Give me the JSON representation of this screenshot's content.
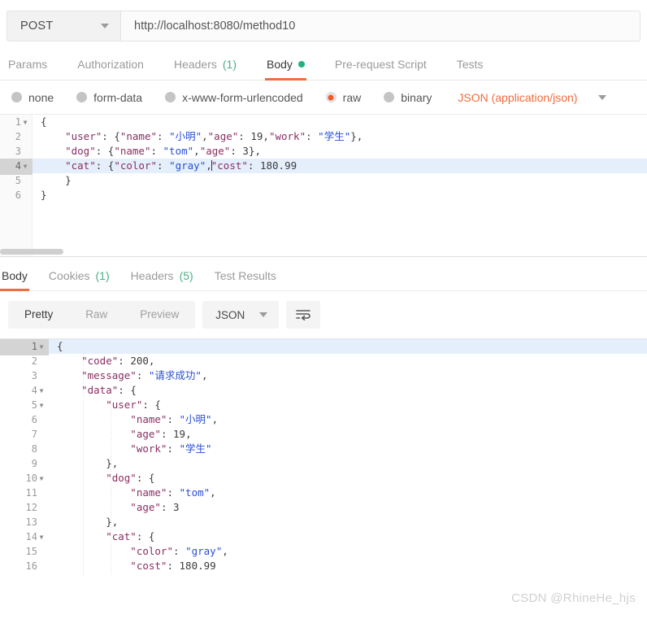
{
  "urlbar": {
    "method": "POST",
    "url": "http://localhost:8080/method10",
    "method_caret": "chevron-down-icon"
  },
  "request_tabs": [
    {
      "label": "Params",
      "active": false,
      "count": "",
      "dot": false
    },
    {
      "label": "Authorization",
      "active": false,
      "count": "",
      "dot": false
    },
    {
      "label": "Headers",
      "active": false,
      "count": "(1)",
      "dot": false
    },
    {
      "label": "Body",
      "active": true,
      "count": "",
      "dot": true
    },
    {
      "label": "Pre-request Script",
      "active": false,
      "count": "",
      "dot": false
    },
    {
      "label": "Tests",
      "active": false,
      "count": "",
      "dot": false
    }
  ],
  "body_types": [
    {
      "label": "none",
      "selected": false
    },
    {
      "label": "form-data",
      "selected": false
    },
    {
      "label": "x-www-form-urlencoded",
      "selected": false
    },
    {
      "label": "raw",
      "selected": true
    },
    {
      "label": "binary",
      "selected": false
    }
  ],
  "content_type": {
    "label": "JSON (application/json)",
    "caret": "chevron-down-icon"
  },
  "request_body": {
    "language": "json",
    "highlighted_line": 4,
    "lines": [
      {
        "n": "1",
        "fold": true,
        "tokens": [
          {
            "t": "{",
            "c": "p"
          }
        ]
      },
      {
        "n": "2",
        "fold": false,
        "tokens": [
          {
            "t": "    \"user\"",
            "c": "k"
          },
          {
            "t": ": {",
            "c": "p"
          },
          {
            "t": "\"name\"",
            "c": "k"
          },
          {
            "t": ": ",
            "c": "p"
          },
          {
            "t": "\"小明\"",
            "c": "s"
          },
          {
            "t": ",",
            "c": "p"
          },
          {
            "t": "\"age\"",
            "c": "k"
          },
          {
            "t": ": ",
            "c": "p"
          },
          {
            "t": "19",
            "c": "n"
          },
          {
            "t": ",",
            "c": "p"
          },
          {
            "t": "\"work\"",
            "c": "k"
          },
          {
            "t": ": ",
            "c": "p"
          },
          {
            "t": "\"学生\"",
            "c": "s"
          },
          {
            "t": "},",
            "c": "p"
          }
        ]
      },
      {
        "n": "3",
        "fold": false,
        "tokens": [
          {
            "t": "    \"dog\"",
            "c": "k"
          },
          {
            "t": ": {",
            "c": "p"
          },
          {
            "t": "\"name\"",
            "c": "k"
          },
          {
            "t": ": ",
            "c": "p"
          },
          {
            "t": "\"tom\"",
            "c": "s"
          },
          {
            "t": ",",
            "c": "p"
          },
          {
            "t": "\"age\"",
            "c": "k"
          },
          {
            "t": ": ",
            "c": "p"
          },
          {
            "t": "3",
            "c": "n"
          },
          {
            "t": "},",
            "c": "p"
          }
        ]
      },
      {
        "n": "4",
        "fold": true,
        "cursor_after": 5,
        "tokens": [
          {
            "t": "    \"cat\"",
            "c": "k"
          },
          {
            "t": ": {",
            "c": "p"
          },
          {
            "t": "\"color\"",
            "c": "k"
          },
          {
            "t": ": ",
            "c": "p"
          },
          {
            "t": "\"gray\"",
            "c": "s"
          },
          {
            "t": ",",
            "c": "p"
          },
          {
            "t": "\"cost\"",
            "c": "k"
          },
          {
            "t": ": ",
            "c": "p"
          },
          {
            "t": "180.99",
            "c": "n"
          }
        ]
      },
      {
        "n": "5",
        "fold": false,
        "tokens": [
          {
            "t": "    }",
            "c": "p"
          }
        ]
      },
      {
        "n": "6",
        "fold": false,
        "tokens": [
          {
            "t": "}",
            "c": "p"
          }
        ]
      }
    ]
  },
  "response_tabs": [
    {
      "label": "Body",
      "active": true,
      "count": ""
    },
    {
      "label": "Cookies",
      "active": false,
      "count": "(1)"
    },
    {
      "label": "Headers",
      "active": false,
      "count": "(5)"
    },
    {
      "label": "Test Results",
      "active": false,
      "count": ""
    }
  ],
  "response_toolbar": {
    "views": [
      {
        "label": "Pretty",
        "active": true
      },
      {
        "label": "Raw",
        "active": false
      },
      {
        "label": "Preview",
        "active": false
      }
    ],
    "format": "JSON",
    "format_caret": "chevron-down-icon",
    "wrap_button": "word-wrap-icon"
  },
  "response_body": {
    "language": "json",
    "highlighted_line": 1,
    "lines": [
      {
        "n": "1",
        "fold": true,
        "tokens": [
          {
            "t": "{",
            "c": "p"
          }
        ]
      },
      {
        "n": "2",
        "fold": false,
        "tokens": [
          {
            "t": "    \"code\"",
            "c": "k"
          },
          {
            "t": ": ",
            "c": "p"
          },
          {
            "t": "200",
            "c": "n"
          },
          {
            "t": ",",
            "c": "p"
          }
        ]
      },
      {
        "n": "3",
        "fold": false,
        "tokens": [
          {
            "t": "    \"message\"",
            "c": "k"
          },
          {
            "t": ": ",
            "c": "p"
          },
          {
            "t": "\"请求成功\"",
            "c": "s"
          },
          {
            "t": ",",
            "c": "p"
          }
        ]
      },
      {
        "n": "4",
        "fold": true,
        "tokens": [
          {
            "t": "    \"data\"",
            "c": "k"
          },
          {
            "t": ": {",
            "c": "p"
          }
        ]
      },
      {
        "n": "5",
        "fold": true,
        "tokens": [
          {
            "t": "        \"user\"",
            "c": "k"
          },
          {
            "t": ": {",
            "c": "p"
          }
        ]
      },
      {
        "n": "6",
        "fold": false,
        "tokens": [
          {
            "t": "            \"name\"",
            "c": "k"
          },
          {
            "t": ": ",
            "c": "p"
          },
          {
            "t": "\"小明\"",
            "c": "s"
          },
          {
            "t": ",",
            "c": "p"
          }
        ]
      },
      {
        "n": "7",
        "fold": false,
        "tokens": [
          {
            "t": "            \"age\"",
            "c": "k"
          },
          {
            "t": ": ",
            "c": "p"
          },
          {
            "t": "19",
            "c": "n"
          },
          {
            "t": ",",
            "c": "p"
          }
        ]
      },
      {
        "n": "8",
        "fold": false,
        "tokens": [
          {
            "t": "            \"work\"",
            "c": "k"
          },
          {
            "t": ": ",
            "c": "p"
          },
          {
            "t": "\"学生\"",
            "c": "s"
          }
        ]
      },
      {
        "n": "9",
        "fold": false,
        "tokens": [
          {
            "t": "        },",
            "c": "p"
          }
        ]
      },
      {
        "n": "10",
        "fold": true,
        "tokens": [
          {
            "t": "        \"dog\"",
            "c": "k"
          },
          {
            "t": ": {",
            "c": "p"
          }
        ]
      },
      {
        "n": "11",
        "fold": false,
        "tokens": [
          {
            "t": "            \"name\"",
            "c": "k"
          },
          {
            "t": ": ",
            "c": "p"
          },
          {
            "t": "\"tom\"",
            "c": "s"
          },
          {
            "t": ",",
            "c": "p"
          }
        ]
      },
      {
        "n": "12",
        "fold": false,
        "tokens": [
          {
            "t": "            \"age\"",
            "c": "k"
          },
          {
            "t": ": ",
            "c": "p"
          },
          {
            "t": "3",
            "c": "n"
          }
        ]
      },
      {
        "n": "13",
        "fold": false,
        "tokens": [
          {
            "t": "        },",
            "c": "p"
          }
        ]
      },
      {
        "n": "14",
        "fold": true,
        "tokens": [
          {
            "t": "        \"cat\"",
            "c": "k"
          },
          {
            "t": ": {",
            "c": "p"
          }
        ]
      },
      {
        "n": "15",
        "fold": false,
        "tokens": [
          {
            "t": "            \"color\"",
            "c": "k"
          },
          {
            "t": ": ",
            "c": "p"
          },
          {
            "t": "\"gray\"",
            "c": "s"
          },
          {
            "t": ",",
            "c": "p"
          }
        ]
      },
      {
        "n": "16",
        "fold": false,
        "tokens": [
          {
            "t": "            \"cost\"",
            "c": "k"
          },
          {
            "t": ": ",
            "c": "p"
          },
          {
            "t": "180.99",
            "c": "n"
          }
        ]
      }
    ]
  },
  "watermark": "CSDN @RhineHe_hjs",
  "colors": {
    "accent": "#ef6c3e",
    "green": "#22b27c",
    "count_green": "#4caf88",
    "key": "#8a2f63",
    "string": "#2a4fd6",
    "highlight": "#e4effb"
  }
}
